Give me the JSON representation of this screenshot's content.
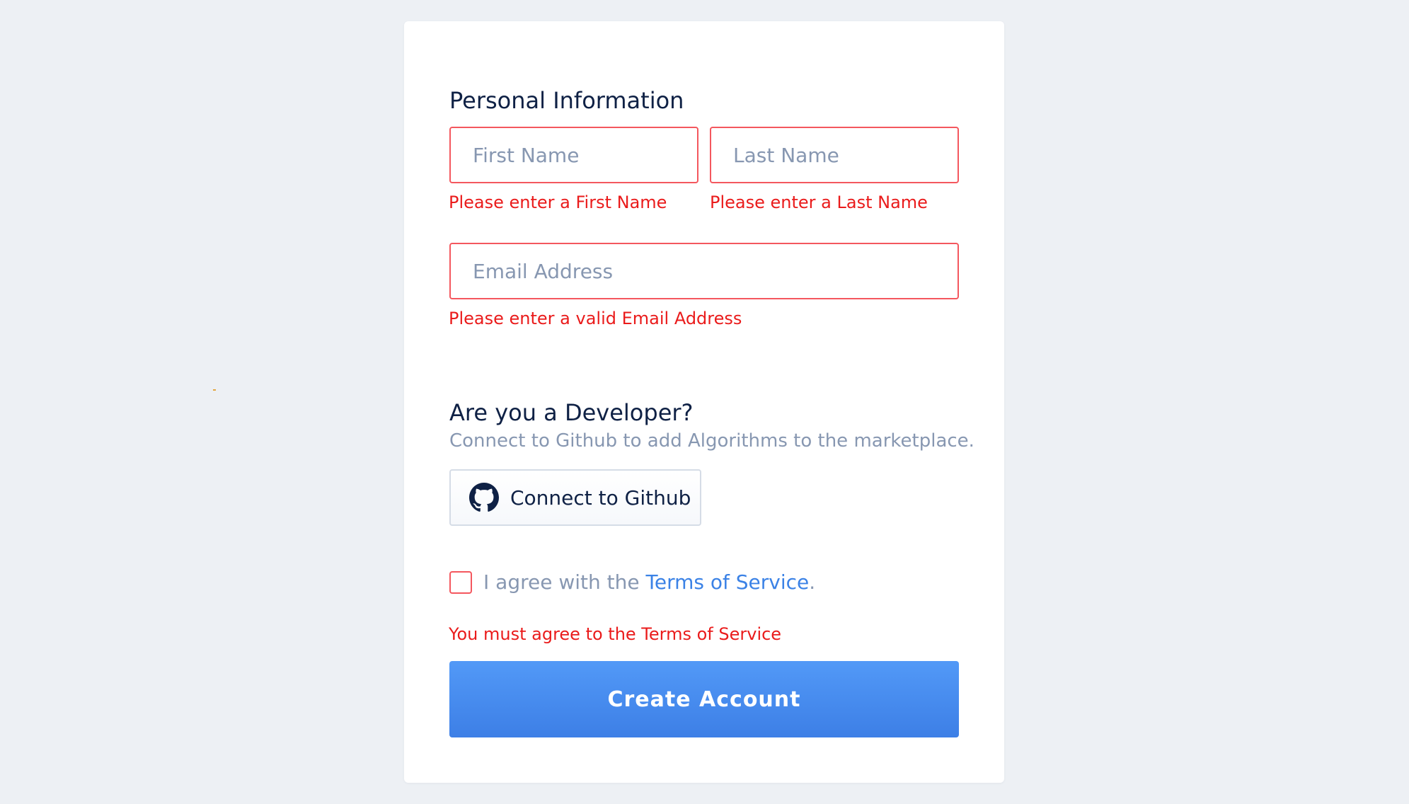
{
  "personal": {
    "title": "Personal Information",
    "first_name": {
      "placeholder": "First Name",
      "value": "",
      "error": "Please enter a First Name"
    },
    "last_name": {
      "placeholder": "Last Name",
      "value": "",
      "error": "Please enter a Last Name"
    },
    "email": {
      "placeholder": "Email Address",
      "value": "",
      "error": "Please enter a valid Email Address"
    }
  },
  "developer": {
    "title": "Are you a Developer?",
    "subtitle": "Connect to Github to add Algorithms to the marketplace.",
    "github_button_label": "Connect to Github",
    "github_icon": "github-icon"
  },
  "terms": {
    "prefix": "I agree with the ",
    "link_label": "Terms of Service",
    "suffix": ".",
    "checked": false,
    "error": "You must agree to the Terms of Service"
  },
  "submit_label": "Create Account",
  "colors": {
    "background": "#edf0f4",
    "card": "#ffffff",
    "heading": "#0f2145",
    "muted": "#8797b1",
    "error_text": "#ea1b1b",
    "error_border": "#f4575e",
    "link": "#3b82e6",
    "primary": "#4a90f0"
  }
}
